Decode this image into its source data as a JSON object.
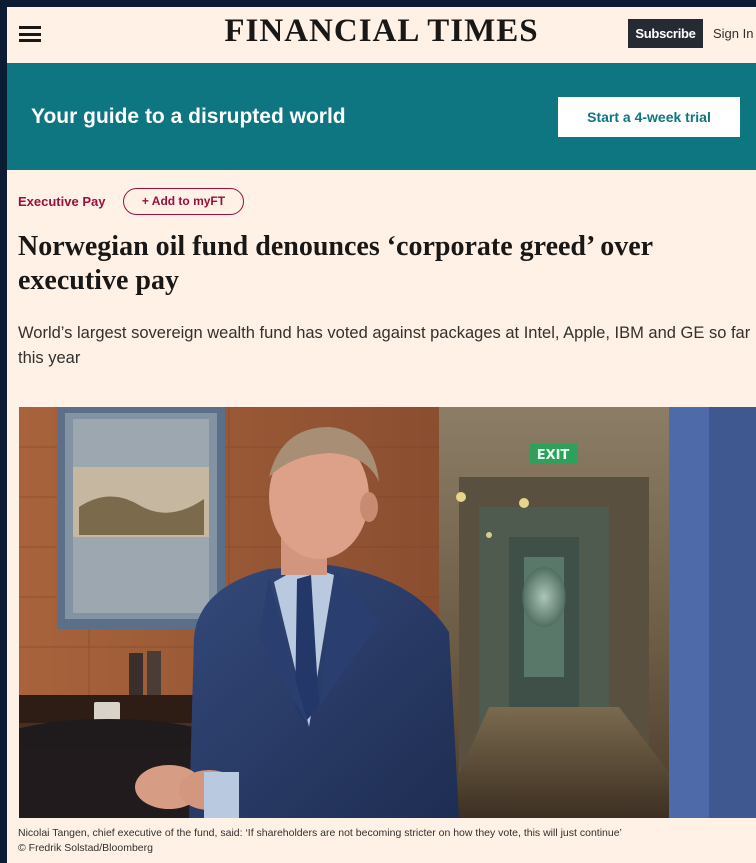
{
  "header": {
    "menu_icon": "hamburger-menu-icon",
    "masthead": "FINANCIAL TIMES",
    "subscribe_label": "Subscribe",
    "signin_label": "Sign In"
  },
  "banner": {
    "text": "Your guide to a disrupted world",
    "cta_label": "Start a 4-week trial",
    "color": "#0d7680"
  },
  "article": {
    "topic": "Executive Pay",
    "add_myft_label": "+ Add to myFT",
    "headline": "Norwegian oil fund denounces ‘corporate greed’ over executive pay",
    "standfirst": "World’s largest sovereign wealth fund has voted against packages at Intel, Apple, IBM and GE so far this year",
    "image": {
      "exit_sign_text": "EXIT"
    },
    "caption_line1": "Nicolai Tangen, chief executive of the fund, said: ‘If shareholders are not becoming stricter on how they vote, this will just continue’",
    "caption_line2": "© Fredrik Solstad/Bloomberg"
  },
  "colors": {
    "page_bg": "#fff1e5",
    "accent_claret": "#990f3d",
    "frame_bg": "#0c1c33"
  }
}
